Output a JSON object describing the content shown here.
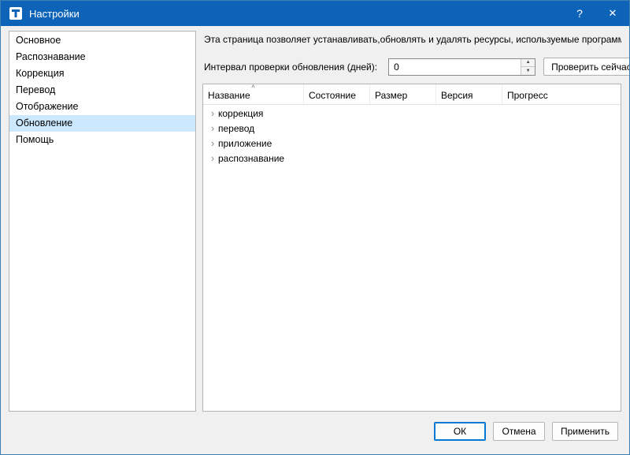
{
  "window": {
    "title": "Настройки"
  },
  "icons": {
    "help": "?",
    "close": "✕",
    "sort_asc": "^",
    "tree_chevron": "›",
    "spin_up": "▲",
    "spin_down": "▼"
  },
  "sidebar": {
    "items": [
      {
        "label": "Основное",
        "selected": false
      },
      {
        "label": "Распознавание",
        "selected": false
      },
      {
        "label": "Коррекция",
        "selected": false
      },
      {
        "label": "Перевод",
        "selected": false
      },
      {
        "label": "Отображение",
        "selected": false
      },
      {
        "label": "Обновление",
        "selected": true
      },
      {
        "label": "Помощь",
        "selected": false
      }
    ]
  },
  "main": {
    "description": "Эта страница позволяет устанавливать,обновлять и удалять ресурсы, используемые программой",
    "interval_label": "Интервал проверки обновления (дней):",
    "interval_value": "0",
    "check_now_label": "Проверить сейчас",
    "table": {
      "columns": [
        "Название",
        "Состояние",
        "Размер",
        "Версия",
        "Прогресс"
      ],
      "rows": [
        {
          "label": "коррекция"
        },
        {
          "label": "перевод"
        },
        {
          "label": "приложение"
        },
        {
          "label": "распознавание"
        }
      ]
    }
  },
  "footer": {
    "ok_label": "ОК",
    "cancel_label": "Отмена",
    "apply_label": "Применить"
  }
}
